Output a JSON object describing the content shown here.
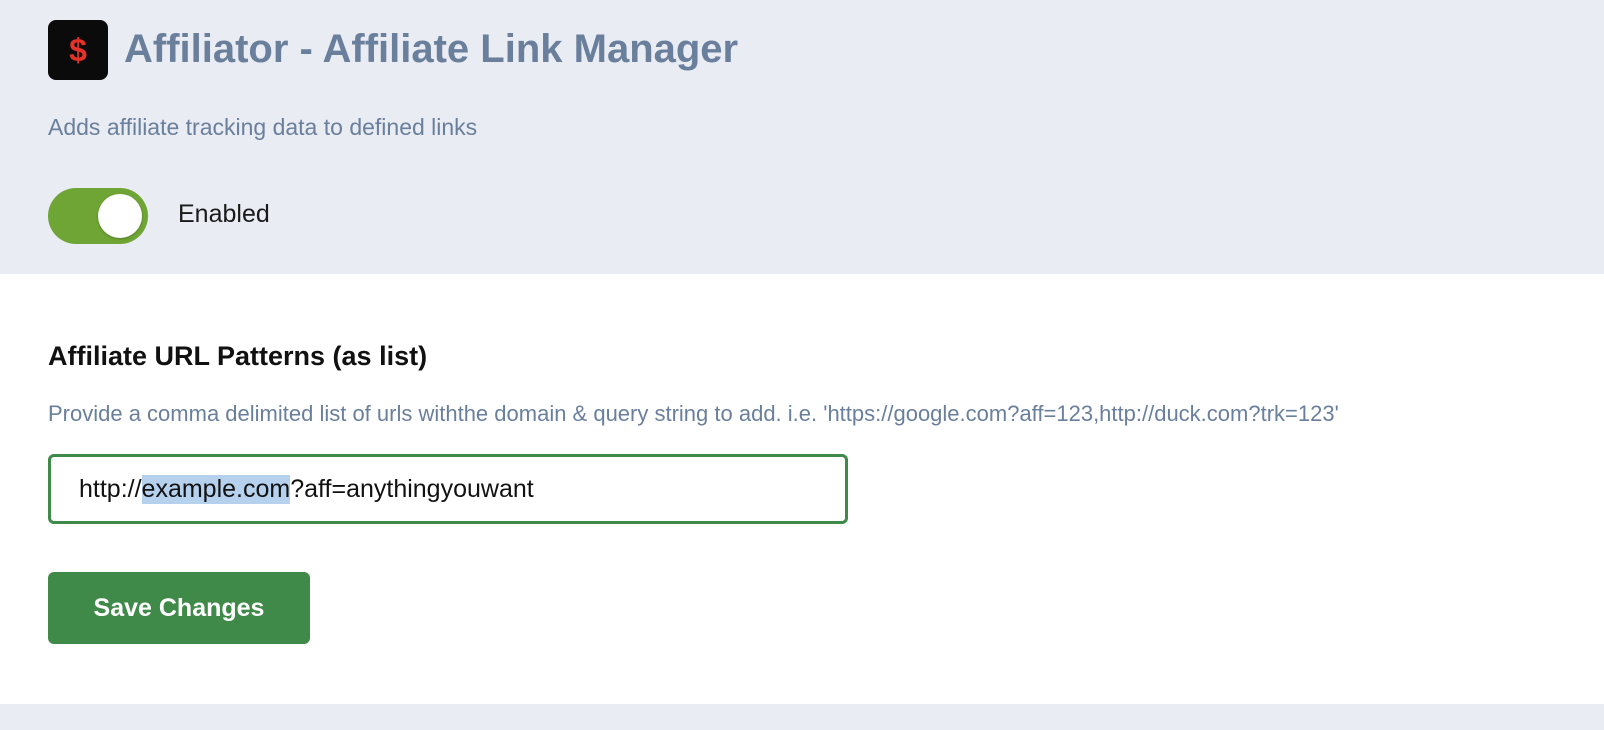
{
  "header": {
    "icon_glyph": "$",
    "title": "Affiliator - Affiliate Link Manager",
    "subtitle": "Adds affiliate tracking data to defined links",
    "toggle": {
      "state": "on",
      "label": "Enabled"
    }
  },
  "settings": {
    "section_title": "Affiliate URL Patterns (as list)",
    "description": "Provide a comma delimited list of urls withthe domain & query string to add. i.e. 'https://google.com?aff=123,http://duck.com?trk=123'",
    "url_input": {
      "value_prefix": "http://",
      "value_selected": "example.com",
      "value_suffix": "?aff=anythingyouwant"
    },
    "save_label": "Save Changes"
  },
  "colors": {
    "accent_green": "#3f8a48",
    "toggle_green": "#6fa534",
    "muted_text": "#6a7f9c",
    "icon_glyph": "#e5322b"
  },
  "icons": {
    "app_icon": "dollar-icon"
  }
}
